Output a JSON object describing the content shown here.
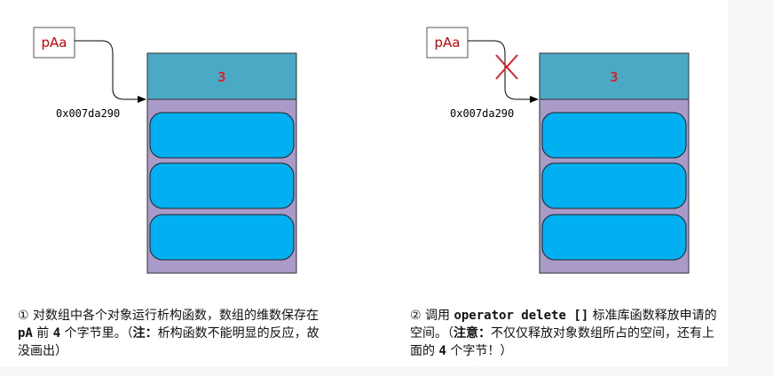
{
  "diagram_left": {
    "pointer_label": "pAa",
    "address": "0x007da290",
    "count_value": "3"
  },
  "diagram_right": {
    "pointer_label": "pAa",
    "address": "0x007da290",
    "count_value": "3"
  },
  "colors": {
    "header": "#4aa9c4",
    "body": "#a99ac9",
    "element": "#00b0f0",
    "cross": "#e02020",
    "label_red": "#cc0000"
  },
  "caption_left": {
    "p1": "① 对数组中各个对象运行析构函数，数组的维数保存在 ",
    "pa": "pA",
    "p2": " 前 ",
    "num": "4",
    "p3": " 个字节里。（",
    "note_label": "注：",
    "p4": "析构函数不能明显的反应，故没画出）"
  },
  "caption_right": {
    "p1": "② 调用 ",
    "code": "operator delete []",
    "p2": " 标准库函数释放申请的空间。（",
    "note_label": "注意：",
    "p3": "不仅仅释放对象数组所占的空间，还有上面的 ",
    "num": "4",
    "p4": " 个字节！）"
  }
}
